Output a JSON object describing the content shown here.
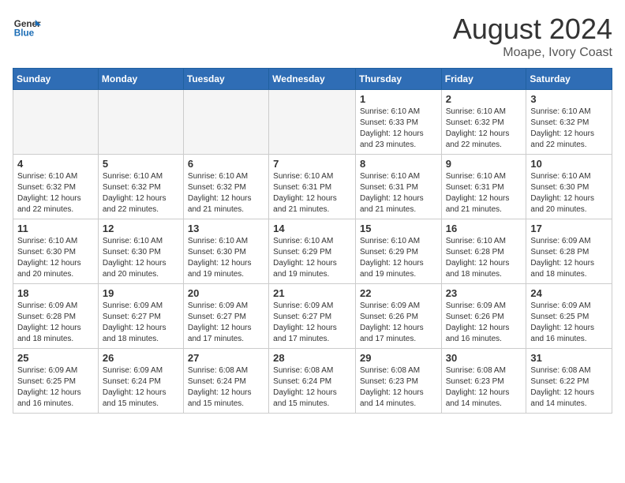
{
  "header": {
    "logo_line1": "General",
    "logo_line2": "Blue",
    "month_year": "August 2024",
    "location": "Moape, Ivory Coast"
  },
  "weekdays": [
    "Sunday",
    "Monday",
    "Tuesday",
    "Wednesday",
    "Thursday",
    "Friday",
    "Saturday"
  ],
  "weeks": [
    [
      {
        "day": "",
        "info": ""
      },
      {
        "day": "",
        "info": ""
      },
      {
        "day": "",
        "info": ""
      },
      {
        "day": "",
        "info": ""
      },
      {
        "day": "1",
        "info": "Sunrise: 6:10 AM\nSunset: 6:33 PM\nDaylight: 12 hours\nand 23 minutes."
      },
      {
        "day": "2",
        "info": "Sunrise: 6:10 AM\nSunset: 6:32 PM\nDaylight: 12 hours\nand 22 minutes."
      },
      {
        "day": "3",
        "info": "Sunrise: 6:10 AM\nSunset: 6:32 PM\nDaylight: 12 hours\nand 22 minutes."
      }
    ],
    [
      {
        "day": "4",
        "info": "Sunrise: 6:10 AM\nSunset: 6:32 PM\nDaylight: 12 hours\nand 22 minutes."
      },
      {
        "day": "5",
        "info": "Sunrise: 6:10 AM\nSunset: 6:32 PM\nDaylight: 12 hours\nand 22 minutes."
      },
      {
        "day": "6",
        "info": "Sunrise: 6:10 AM\nSunset: 6:32 PM\nDaylight: 12 hours\nand 21 minutes."
      },
      {
        "day": "7",
        "info": "Sunrise: 6:10 AM\nSunset: 6:31 PM\nDaylight: 12 hours\nand 21 minutes."
      },
      {
        "day": "8",
        "info": "Sunrise: 6:10 AM\nSunset: 6:31 PM\nDaylight: 12 hours\nand 21 minutes."
      },
      {
        "day": "9",
        "info": "Sunrise: 6:10 AM\nSunset: 6:31 PM\nDaylight: 12 hours\nand 21 minutes."
      },
      {
        "day": "10",
        "info": "Sunrise: 6:10 AM\nSunset: 6:30 PM\nDaylight: 12 hours\nand 20 minutes."
      }
    ],
    [
      {
        "day": "11",
        "info": "Sunrise: 6:10 AM\nSunset: 6:30 PM\nDaylight: 12 hours\nand 20 minutes."
      },
      {
        "day": "12",
        "info": "Sunrise: 6:10 AM\nSunset: 6:30 PM\nDaylight: 12 hours\nand 20 minutes."
      },
      {
        "day": "13",
        "info": "Sunrise: 6:10 AM\nSunset: 6:30 PM\nDaylight: 12 hours\nand 19 minutes."
      },
      {
        "day": "14",
        "info": "Sunrise: 6:10 AM\nSunset: 6:29 PM\nDaylight: 12 hours\nand 19 minutes."
      },
      {
        "day": "15",
        "info": "Sunrise: 6:10 AM\nSunset: 6:29 PM\nDaylight: 12 hours\nand 19 minutes."
      },
      {
        "day": "16",
        "info": "Sunrise: 6:10 AM\nSunset: 6:28 PM\nDaylight: 12 hours\nand 18 minutes."
      },
      {
        "day": "17",
        "info": "Sunrise: 6:09 AM\nSunset: 6:28 PM\nDaylight: 12 hours\nand 18 minutes."
      }
    ],
    [
      {
        "day": "18",
        "info": "Sunrise: 6:09 AM\nSunset: 6:28 PM\nDaylight: 12 hours\nand 18 minutes."
      },
      {
        "day": "19",
        "info": "Sunrise: 6:09 AM\nSunset: 6:27 PM\nDaylight: 12 hours\nand 18 minutes."
      },
      {
        "day": "20",
        "info": "Sunrise: 6:09 AM\nSunset: 6:27 PM\nDaylight: 12 hours\nand 17 minutes."
      },
      {
        "day": "21",
        "info": "Sunrise: 6:09 AM\nSunset: 6:27 PM\nDaylight: 12 hours\nand 17 minutes."
      },
      {
        "day": "22",
        "info": "Sunrise: 6:09 AM\nSunset: 6:26 PM\nDaylight: 12 hours\nand 17 minutes."
      },
      {
        "day": "23",
        "info": "Sunrise: 6:09 AM\nSunset: 6:26 PM\nDaylight: 12 hours\nand 16 minutes."
      },
      {
        "day": "24",
        "info": "Sunrise: 6:09 AM\nSunset: 6:25 PM\nDaylight: 12 hours\nand 16 minutes."
      }
    ],
    [
      {
        "day": "25",
        "info": "Sunrise: 6:09 AM\nSunset: 6:25 PM\nDaylight: 12 hours\nand 16 minutes."
      },
      {
        "day": "26",
        "info": "Sunrise: 6:09 AM\nSunset: 6:24 PM\nDaylight: 12 hours\nand 15 minutes."
      },
      {
        "day": "27",
        "info": "Sunrise: 6:08 AM\nSunset: 6:24 PM\nDaylight: 12 hours\nand 15 minutes."
      },
      {
        "day": "28",
        "info": "Sunrise: 6:08 AM\nSunset: 6:24 PM\nDaylight: 12 hours\nand 15 minutes."
      },
      {
        "day": "29",
        "info": "Sunrise: 6:08 AM\nSunset: 6:23 PM\nDaylight: 12 hours\nand 14 minutes."
      },
      {
        "day": "30",
        "info": "Sunrise: 6:08 AM\nSunset: 6:23 PM\nDaylight: 12 hours\nand 14 minutes."
      },
      {
        "day": "31",
        "info": "Sunrise: 6:08 AM\nSunset: 6:22 PM\nDaylight: 12 hours\nand 14 minutes."
      }
    ]
  ]
}
